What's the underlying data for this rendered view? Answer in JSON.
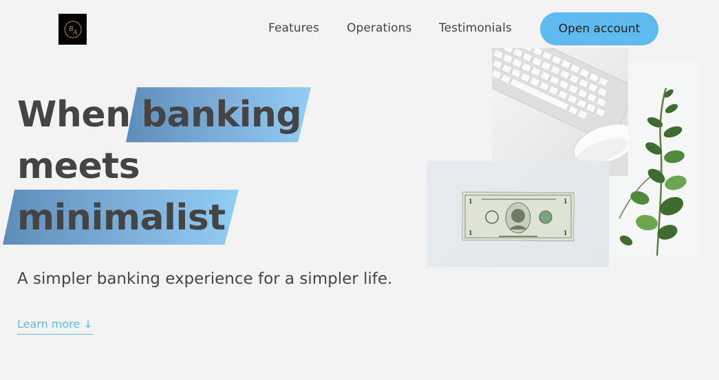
{
  "nav": {
    "logo_letters": "BA",
    "links": [
      "Features",
      "Operations",
      "Testimonials"
    ],
    "cta_label": "Open account"
  },
  "hero": {
    "headline": {
      "word1": "When",
      "word2_highlighted": "banking",
      "line2": "meets",
      "line3_highlighted": "minimalist"
    },
    "subtitle": "A simpler banking experience for a simpler life.",
    "learn_more": "Learn more ↓",
    "images": [
      "keyboard-and-mouse-photo",
      "dollar-bill-photo",
      "plant-photo"
    ]
  },
  "colors": {
    "background": "#f3f3f3",
    "accent": "#5ebaef",
    "highlight_start": "#5f8dba",
    "highlight_end": "#91cdf3",
    "text": "#444444"
  }
}
